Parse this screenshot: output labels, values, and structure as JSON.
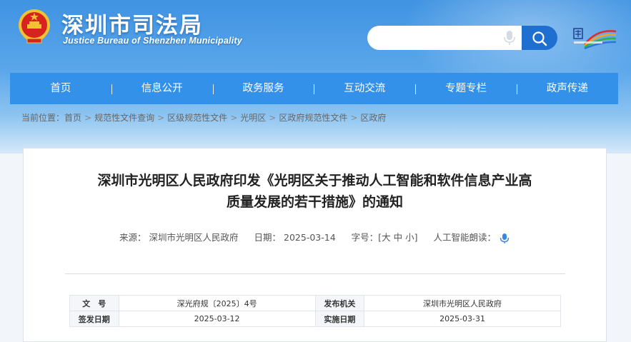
{
  "header": {
    "site_name": "深圳市司法局",
    "site_name_en": "Justice Bureau of Shenzhen Municipality",
    "search_placeholder": ""
  },
  "nav": {
    "items": [
      {
        "label": "首页"
      },
      {
        "label": "信息公开"
      },
      {
        "label": "政务服务"
      },
      {
        "label": "互动交流"
      },
      {
        "label": "专题专栏"
      },
      {
        "label": "政声传递"
      }
    ]
  },
  "breadcrumb": {
    "prefix": "当前位置：",
    "items": [
      "首页",
      "规范性文件查询",
      "区级规范性文件",
      "光明区",
      "区政府规范性文件",
      "区政府"
    ]
  },
  "article": {
    "title_line1": "深圳市光明区人民政府印发《光明区关于推动人工智能和软件信息产业高",
    "title_line2": "质量发展的若干措施》的通知",
    "source_label": "来源：",
    "source_value": "深圳市光明区人民政府",
    "date_label": "日期：",
    "date_value": "2025-03-14",
    "font_label": "字号：",
    "font_open": "[",
    "font_large": "大",
    "font_medium": "中",
    "font_small": "小",
    "font_close": "]",
    "ai_read_label": "人工智能朗读："
  },
  "info_table": {
    "doc_no_label": "文　号",
    "doc_no_value": "深光府规〔2025〕4号",
    "issuer_label": "发布机关",
    "issuer_value": "深圳市光明区人民政府",
    "sign_date_label": "签发日期",
    "sign_date_value": "2025-03-12",
    "effective_date_label": "实施日期",
    "effective_date_value": "2025-03-31"
  },
  "colors": {
    "nav_bg": "#3491ea",
    "search_button": "#1e6fd0",
    "title_text": "#222222"
  },
  "icons": {
    "emblem": "national-emblem-icon",
    "mic": "mic-icon",
    "search": "search-icon",
    "pride_logo": "shenzhen-pride-logo",
    "speaker": "speaker-icon"
  }
}
